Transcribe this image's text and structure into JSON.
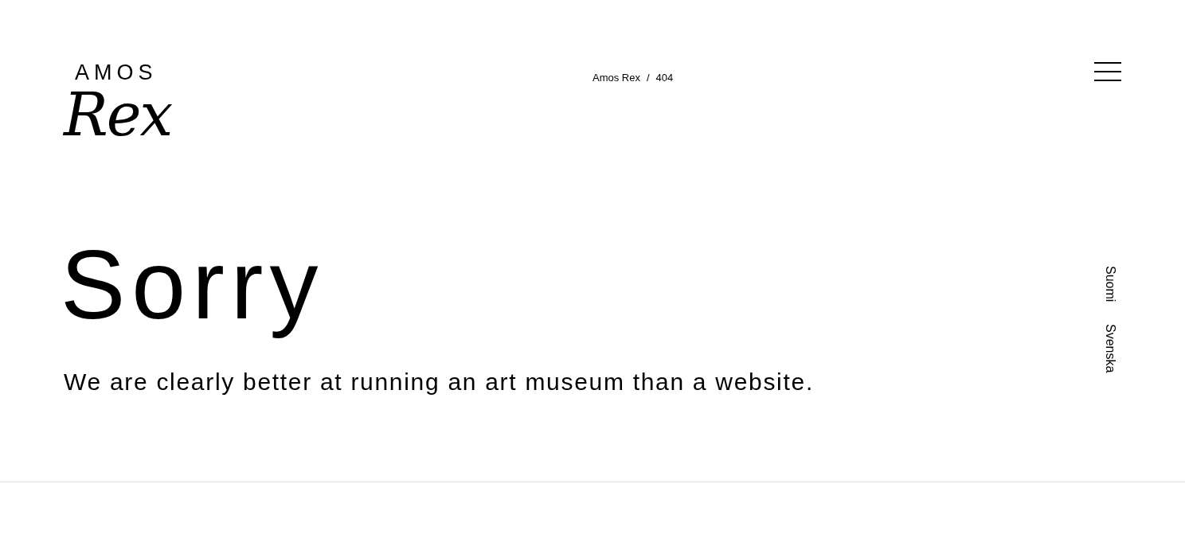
{
  "logo": {
    "top": "AMOS",
    "script": "Rex"
  },
  "breadcrumb": [
    {
      "label": "Amos Rex"
    },
    {
      "label": "404"
    }
  ],
  "separator": "/",
  "heading": "Sorry",
  "message": "We are clearly better at running an art museum than a website.",
  "languages": [
    {
      "label": "Suomi"
    },
    {
      "label": "Svenska"
    }
  ]
}
